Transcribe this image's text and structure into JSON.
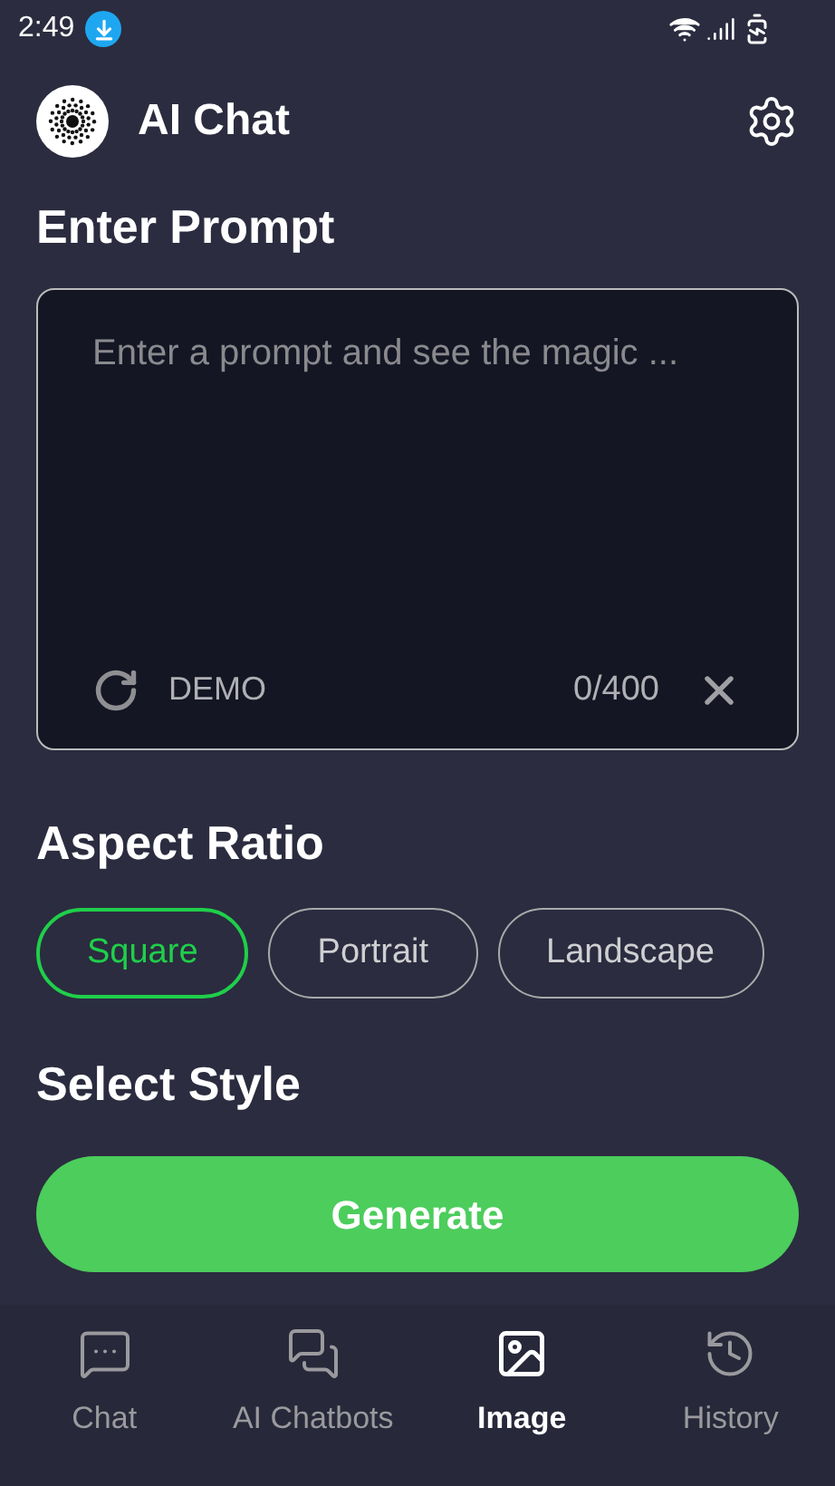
{
  "status_bar": {
    "time": "2:49"
  },
  "header": {
    "title": "AI Chat"
  },
  "prompt_section": {
    "title": "Enter Prompt",
    "placeholder": "Enter a prompt and see the magic ...",
    "demo_label": "DEMO",
    "counter": "0/400"
  },
  "aspect_section": {
    "title": "Aspect Ratio",
    "options": [
      {
        "label": "Square",
        "selected": true
      },
      {
        "label": "Portrait",
        "selected": false
      },
      {
        "label": "Landscape",
        "selected": false
      }
    ]
  },
  "style_section": {
    "title": "Select Style"
  },
  "generate_button": {
    "label": "Generate"
  },
  "bottom_nav": [
    {
      "label": "Chat",
      "kind": "chat",
      "selected": false
    },
    {
      "label": "AI Chatbots",
      "kind": "chatbots",
      "selected": false
    },
    {
      "label": "Image",
      "kind": "image",
      "selected": true
    },
    {
      "label": "History",
      "kind": "history",
      "selected": false
    }
  ]
}
